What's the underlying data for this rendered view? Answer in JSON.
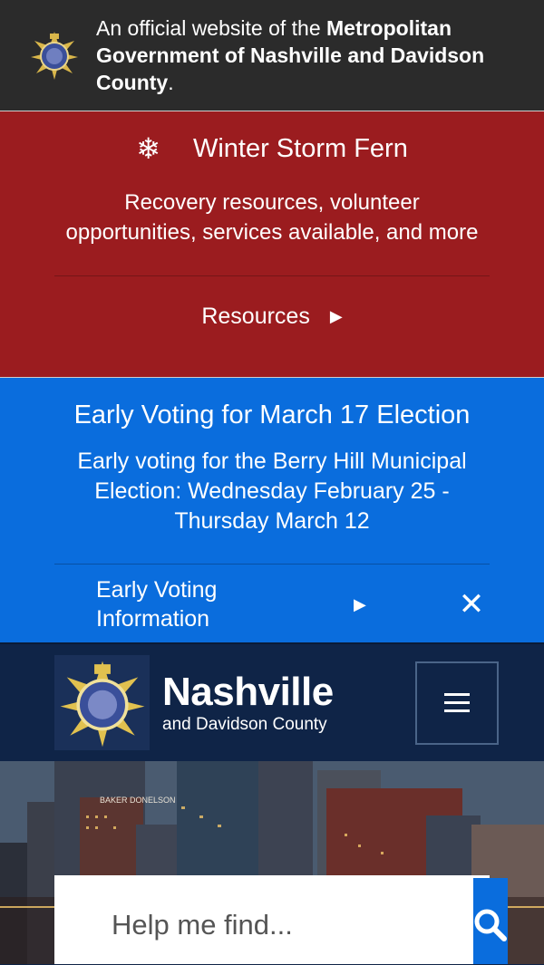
{
  "official_banner": {
    "prefix": "An official website of the ",
    "bold": "Metropolitan Government of Nashville and Davidson County",
    "suffix": ".",
    "seal_icon": "metro-seal-icon"
  },
  "alert_storm": {
    "icon": "snowflake-icon",
    "title": "Winter Storm Fern",
    "description": "Recovery resources, volunteer opportunities, services available, and more",
    "link_label": "Resources",
    "color": "#9b1c1f"
  },
  "alert_voting": {
    "title": "Early Voting for March 17 Election",
    "description": "Early voting for the Berry Hill Municipal Election: Wednesday February 25 - Thursday March 12",
    "link_label": "Early Voting Information",
    "color": "#0a6ddd"
  },
  "header": {
    "brand_name": "Nashville",
    "brand_sub": "and Davidson County",
    "menu_icon": "hamburger-menu-icon"
  },
  "hero": {
    "building_sign": "BAKER DONELSON",
    "search_placeholder": "Help me find...",
    "search_icon": "search-icon"
  }
}
